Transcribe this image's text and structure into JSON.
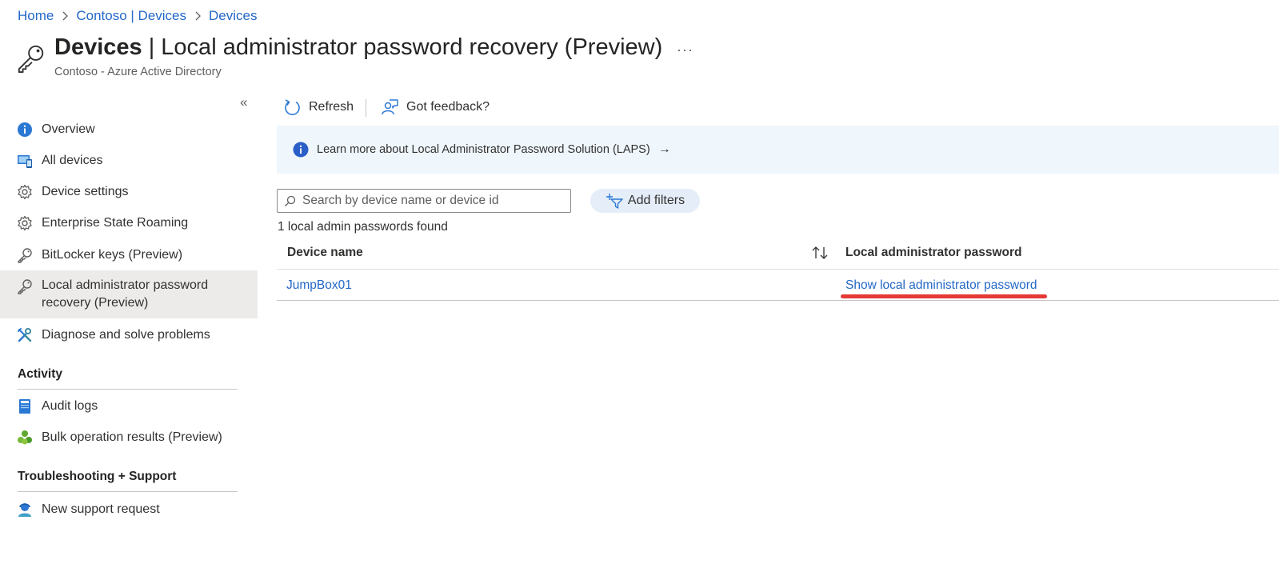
{
  "breadcrumb": [
    "Home",
    "Contoso | Devices",
    "Devices"
  ],
  "header": {
    "title_bold": "Devices",
    "title_rest": " | Local administrator password recovery (Preview)",
    "more": "···",
    "subtitle": "Contoso - Azure Active Directory",
    "icon": "key-icon"
  },
  "sidebar": {
    "collapse": "«",
    "items": [
      {
        "label": "Overview",
        "icon": "info-icon"
      },
      {
        "label": "All devices",
        "icon": "devices-icon"
      },
      {
        "label": "Device settings",
        "icon": "gear-icon"
      },
      {
        "label": "Enterprise State Roaming",
        "icon": "gear-icon"
      },
      {
        "label": "BitLocker keys (Preview)",
        "icon": "key-icon"
      },
      {
        "label": "Local administrator password recovery (Preview)",
        "label_line1": "Local administrator password",
        "label_line2": "recovery (Preview)",
        "icon": "key-icon",
        "active": true
      },
      {
        "label": "Diagnose and solve problems",
        "icon": "wrench-icon"
      }
    ],
    "sections": [
      {
        "title": "Activity",
        "items": [
          {
            "label": "Audit logs",
            "icon": "log-icon"
          },
          {
            "label": "Bulk operation results (Preview)",
            "icon": "bulk-icon"
          }
        ]
      },
      {
        "title": "Troubleshooting + Support",
        "items": [
          {
            "label": "New support request",
            "icon": "support-icon"
          }
        ]
      }
    ]
  },
  "toolbar": {
    "refresh": "Refresh",
    "feedback": "Got feedback?"
  },
  "banner": {
    "text": "Learn more about Local Administrator Password Solution (LAPS)",
    "arrow": "→"
  },
  "search": {
    "placeholder": "Search by device name or device id",
    "value": ""
  },
  "filters": {
    "label": "Add filters"
  },
  "results": {
    "count_text": "1 local admin passwords found"
  },
  "table": {
    "columns": [
      "Device name",
      "Local administrator password"
    ],
    "rows": [
      {
        "device": "JumpBox01",
        "action": "Show local administrator password"
      }
    ]
  },
  "colors": {
    "accent": "#2468c8",
    "highlight": "#e53935",
    "banner_bg": "#eff6fc"
  }
}
